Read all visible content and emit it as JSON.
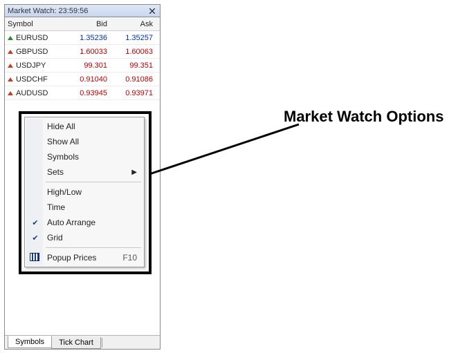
{
  "panel": {
    "title_prefix": "Market Watch:",
    "time": "23:59:56",
    "title": "Market Watch: 23:59:56"
  },
  "columns": {
    "symbol": "Symbol",
    "bid": "Bid",
    "ask": "Ask"
  },
  "rows": [
    {
      "symbol": "EURUSD",
      "bid": "1.35236",
      "ask": "1.35257",
      "dir": "up"
    },
    {
      "symbol": "GBPUSD",
      "bid": "1.60033",
      "ask": "1.60063",
      "dir": "down"
    },
    {
      "symbol": "USDJPY",
      "bid": "99.301",
      "ask": "99.351",
      "dir": "down"
    },
    {
      "symbol": "USDCHF",
      "bid": "0.91040",
      "ask": "0.91086",
      "dir": "down"
    },
    {
      "symbol": "AUDUSD",
      "bid": "0.93945",
      "ask": "0.93971",
      "dir": "down"
    }
  ],
  "context_menu": {
    "hide_all": "Hide All",
    "show_all": "Show All",
    "symbols": "Symbols",
    "sets": "Sets",
    "high_low": "High/Low",
    "time": "Time",
    "auto_arrange": "Auto Arrange",
    "grid": "Grid",
    "popup_prices": "Popup Prices",
    "popup_shortcut": "F10",
    "checked": {
      "auto_arrange": true,
      "grid": true
    }
  },
  "tabs": {
    "symbols": "Symbols",
    "tick_chart": "Tick Chart",
    "active": "symbols"
  },
  "annotation": {
    "label": "Market Watch Options"
  },
  "colors": {
    "price_up": "#0030c0",
    "price_down": "#c00000",
    "arrow_up": "#2a8a2a",
    "arrow_down": "#c04020"
  }
}
